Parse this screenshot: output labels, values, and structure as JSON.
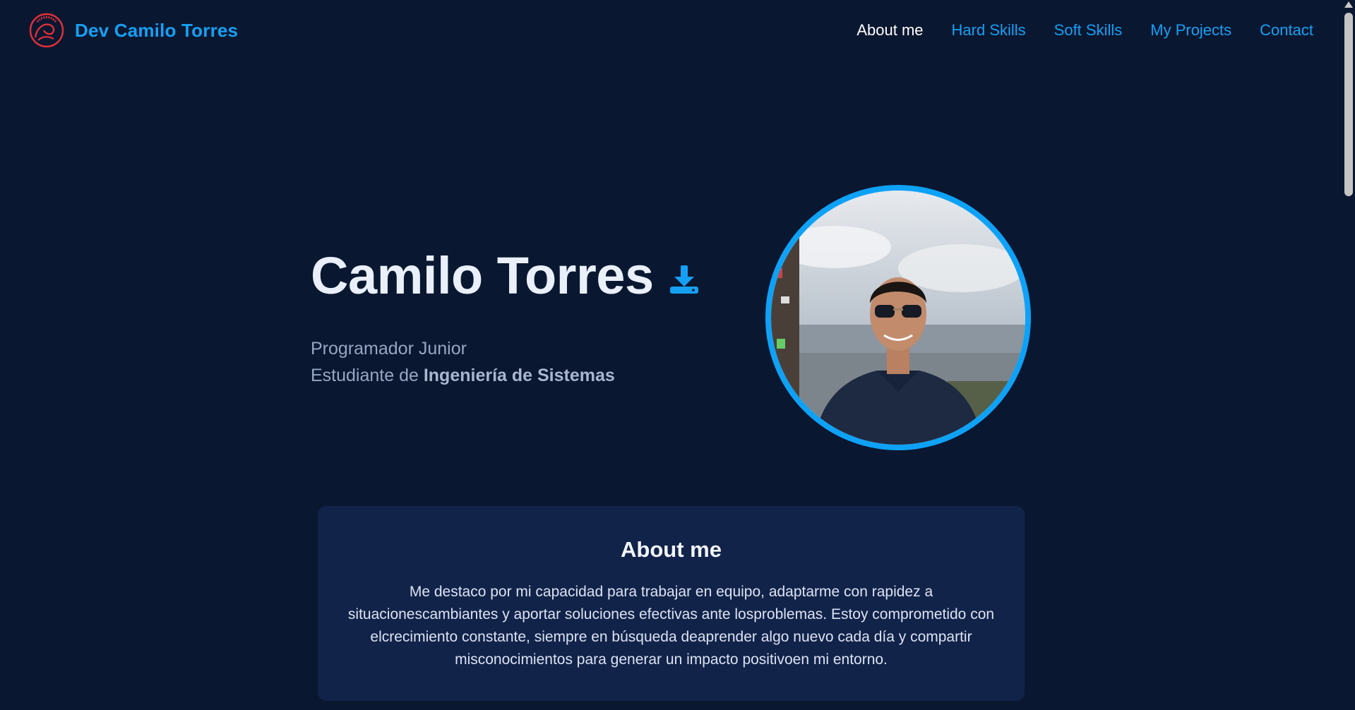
{
  "header": {
    "brand_name": "Dev Camilo Torres",
    "logo_text": "UNILLANOS"
  },
  "nav": {
    "items": [
      {
        "label": "About me",
        "active": true
      },
      {
        "label": "Hard Skills",
        "active": false
      },
      {
        "label": "Soft Skills",
        "active": false
      },
      {
        "label": "My Projects",
        "active": false
      },
      {
        "label": "Contact",
        "active": false
      }
    ]
  },
  "hero": {
    "name": "Camilo Torres",
    "role": "Programador Junior",
    "study_prefix": "Estudiante de ",
    "study_field": "Ingeniería de Sistemas",
    "download_icon": "download-icon"
  },
  "about": {
    "title": "About me",
    "text": "Me destaco por mi capacidad para trabajar en equipo, adaptarme con rapidez a situacionescambiantes y aportar soluciones efectivas ante losproblemas. Estoy comprometido con elcrecimiento constante, siempre en búsqueda deaprender algo nuevo cada día y compartir misconocimientos para generar un impacto positivoen mi entorno."
  },
  "colors": {
    "background": "#0a1730",
    "accent": "#15a0f4",
    "card": "#12234a",
    "logo_red": "#e0303a"
  }
}
